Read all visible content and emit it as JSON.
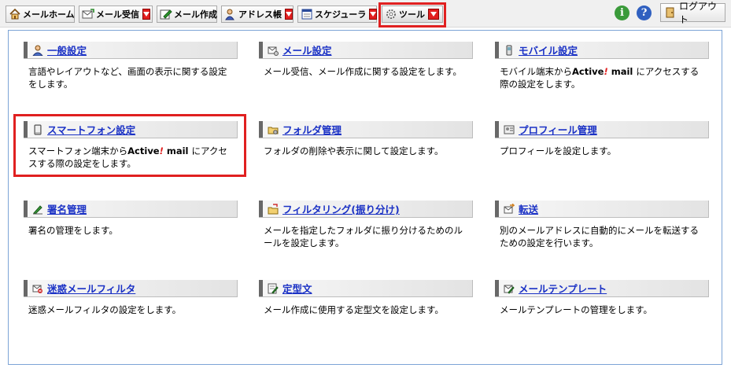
{
  "toolbar": {
    "mail_home": "メールホーム",
    "mail_receive": "メール受信",
    "mail_compose": "メール作成",
    "address_book": "アドレス帳",
    "scheduler": "スケジューラ",
    "tools": "ツール",
    "info_icon": "i",
    "help_icon": "?",
    "logout": "ログアウト"
  },
  "items": [
    {
      "title": "一般設定",
      "icon": "person-icon",
      "desc": "言語やレイアウトなど、画面の表示に関する設定をします。"
    },
    {
      "title": "メール設定",
      "icon": "mail-settings-icon",
      "desc": "メール受信、メール作成に関する設定をします。"
    },
    {
      "title": "モバイル設定",
      "icon": "mobile-icon",
      "desc_pre": "モバイル端末から",
      "desc_post": "にアクセスする際の設定をします。"
    },
    {
      "title": "スマートフォン設定",
      "icon": "smartphone-icon",
      "desc_pre": "スマートフォン端末から",
      "desc_post": "にアクセスする際の設定をします。"
    },
    {
      "title": "フォルダ管理",
      "icon": "folder-icon",
      "desc": "フォルダの削除や表示に関して設定します。"
    },
    {
      "title": "プロフィール管理",
      "icon": "profile-card-icon",
      "desc": "プロフィールを設定します。"
    },
    {
      "title": "署名管理",
      "icon": "pen-icon",
      "desc": "署名の管理をします。"
    },
    {
      "title": "フィルタリング(振り分け)",
      "icon": "filter-folder-icon",
      "desc": "メールを指定したフォルダに振り分けるためのルールを設定します。"
    },
    {
      "title": "転送",
      "icon": "forward-icon",
      "desc": "別のメールアドレスに自動的にメールを転送するための設定を行います。"
    },
    {
      "title": "迷惑メールフィルタ",
      "icon": "spam-icon",
      "desc": "迷惑メールフィルタの設定をします。"
    },
    {
      "title": "定型文",
      "icon": "template-text-icon",
      "desc": "メール作成に使用する定型文を設定します。"
    },
    {
      "title": "メールテンプレート",
      "icon": "mail-template-icon",
      "desc": "メールテンプレートの管理をします。"
    }
  ],
  "brand": {
    "name_a": "Active",
    "name_ex": "!",
    "name_b": " mail "
  },
  "colors": {
    "link": "#1a31c5",
    "highlight": "#e02020",
    "panel_border": "#7ca4d6",
    "dropdown": "#e21f1f"
  }
}
